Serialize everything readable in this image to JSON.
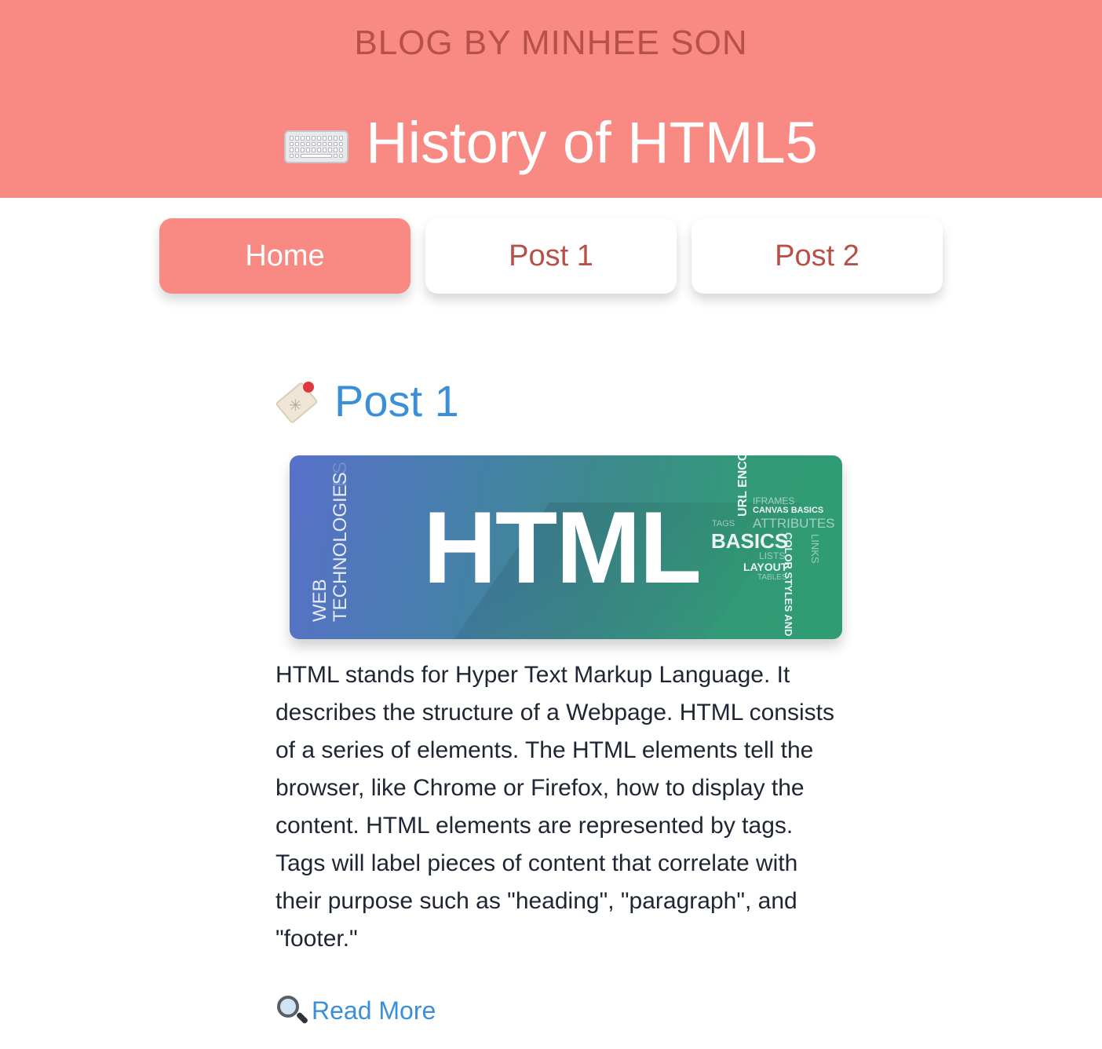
{
  "header": {
    "byline": "BLOG BY MINHEE SON",
    "title": "History of HTML5",
    "title_icon": "keyboard-icon",
    "background_color": "#f88a83",
    "byline_color": "#b8504a"
  },
  "nav": {
    "items": [
      {
        "label": "Home",
        "active": true
      },
      {
        "label": "Post 1",
        "active": false
      },
      {
        "label": "Post 2",
        "active": false
      }
    ]
  },
  "post": {
    "icon": "tag-icon",
    "title": "Post 1",
    "title_color": "#3b8fd9",
    "banner": {
      "main_text": "HTML",
      "side_text": [
        "WEB",
        "TECHNOLOGIES",
        "ES"
      ],
      "word_cloud": {
        "urlencod": "URL ENCOD",
        "iframes": "IFRAMES",
        "canvas": "CANVAS BASICS",
        "tags": "TAGS",
        "attributes": "ATTRIBUTES",
        "basics": "BASICS",
        "lists": "LISTS",
        "layout": "LAYOUT",
        "tables": "TABLES",
        "color": "COLOR STYLES AND",
        "links": "LINKS"
      }
    },
    "body": "HTML stands for Hyper Text Markup Language. It describes the structure of a Webpage. HTML consists of a series of elements. The HTML elements tell the browser, like Chrome or Firefox, how to display the content. HTML elements are represented by tags. Tags will label pieces of content that correlate with their purpose such as \"heading\", \"paragraph\", and \"footer.\"",
    "read_more_icon": "magnifier-icon",
    "read_more": "Read More"
  }
}
